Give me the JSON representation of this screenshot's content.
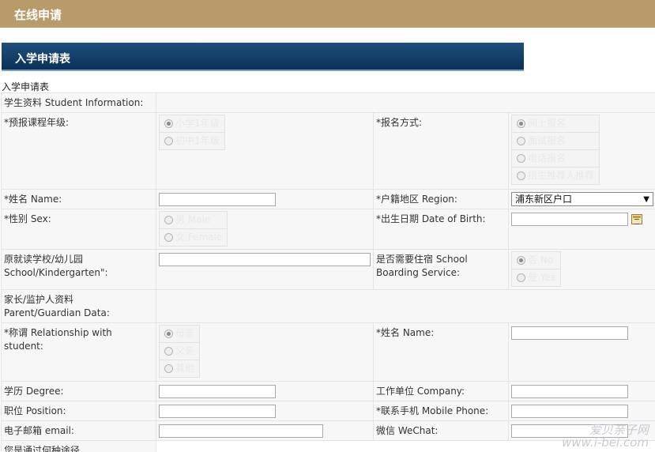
{
  "banner": {
    "title": "在线申请"
  },
  "section": {
    "title": "入学申请表"
  },
  "form_caption": "入学申请表",
  "student": {
    "heading": "学生资料 Student Information:",
    "grade": {
      "label": "*预报课程年级:",
      "options": [
        "小学1年级",
        "初中1年级"
      ]
    },
    "method": {
      "label": "*报名方式:",
      "options": [
        "网上报名",
        "面试报名",
        "电话报名",
        "招生推荐人推荐"
      ]
    },
    "name": {
      "label": "*姓名 Name:",
      "value": ""
    },
    "region": {
      "label": "*户籍地区 Region:",
      "selected": "浦东新区户口"
    },
    "sex": {
      "label": "*性别 Sex:",
      "options": [
        "男 Male",
        "女 Female"
      ]
    },
    "dob": {
      "label": "*出生日期 Date of Birth:",
      "value": ""
    },
    "school": {
      "label": "原就读学校/幼儿园 School/Kindergarten\":",
      "value": ""
    },
    "boarding": {
      "label": "是否需要住宿 School Boarding Service:",
      "options": [
        "否 No",
        "是 Yes"
      ]
    }
  },
  "parent": {
    "heading": "家长/监护人资料 Parent/Guardian Data:",
    "relationship": {
      "label": "*称谓 Relationship with student:",
      "options": [
        "母亲",
        "父亲",
        "其他"
      ]
    },
    "name": {
      "label": "*姓名 Name:",
      "value": ""
    },
    "degree": {
      "label": "学历 Degree:",
      "value": ""
    },
    "company": {
      "label": "工作单位 Company:",
      "value": ""
    },
    "position": {
      "label": "职位 Position:",
      "value": ""
    },
    "mobile": {
      "label": "*联系手机 Mobile Phone:",
      "value": ""
    },
    "email": {
      "label": "电子邮箱 email:",
      "value": ""
    },
    "wechat": {
      "label": "微信 WeChat:",
      "value": ""
    }
  },
  "source": {
    "label": "您是通过何种途径"
  },
  "watermark": {
    "line1": "爱贝亲子网",
    "line2": "www.i-bei.com"
  },
  "colors": {
    "banner": "#b99a6a",
    "section_bar": "#0b3157",
    "cell_bg": "#f7f7f7",
    "border": "#e4e4e4"
  },
  "icons": {
    "select_arrow": "chevron-down-icon",
    "calendar": "calendar-icon"
  }
}
